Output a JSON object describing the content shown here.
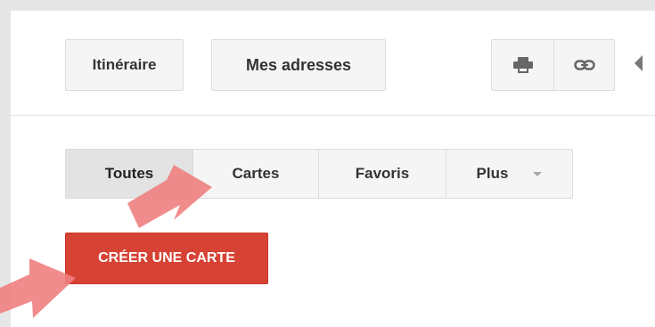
{
  "toolbar": {
    "itinerary_label": "Itinéraire",
    "my_addresses_label": "Mes adresses",
    "print_icon": "print-icon",
    "link_icon": "link-icon",
    "collapse_icon": "collapse-left-icon"
  },
  "filters": {
    "tabs": [
      {
        "label": "Toutes",
        "active": true
      },
      {
        "label": "Cartes",
        "active": false
      },
      {
        "label": "Favoris",
        "active": false
      },
      {
        "label": "Plus",
        "active": false
      }
    ]
  },
  "create_map": {
    "label": "CRÉER UNE CARTE"
  },
  "colors": {
    "create_button": "#d64234",
    "arrow": "#f08080"
  }
}
